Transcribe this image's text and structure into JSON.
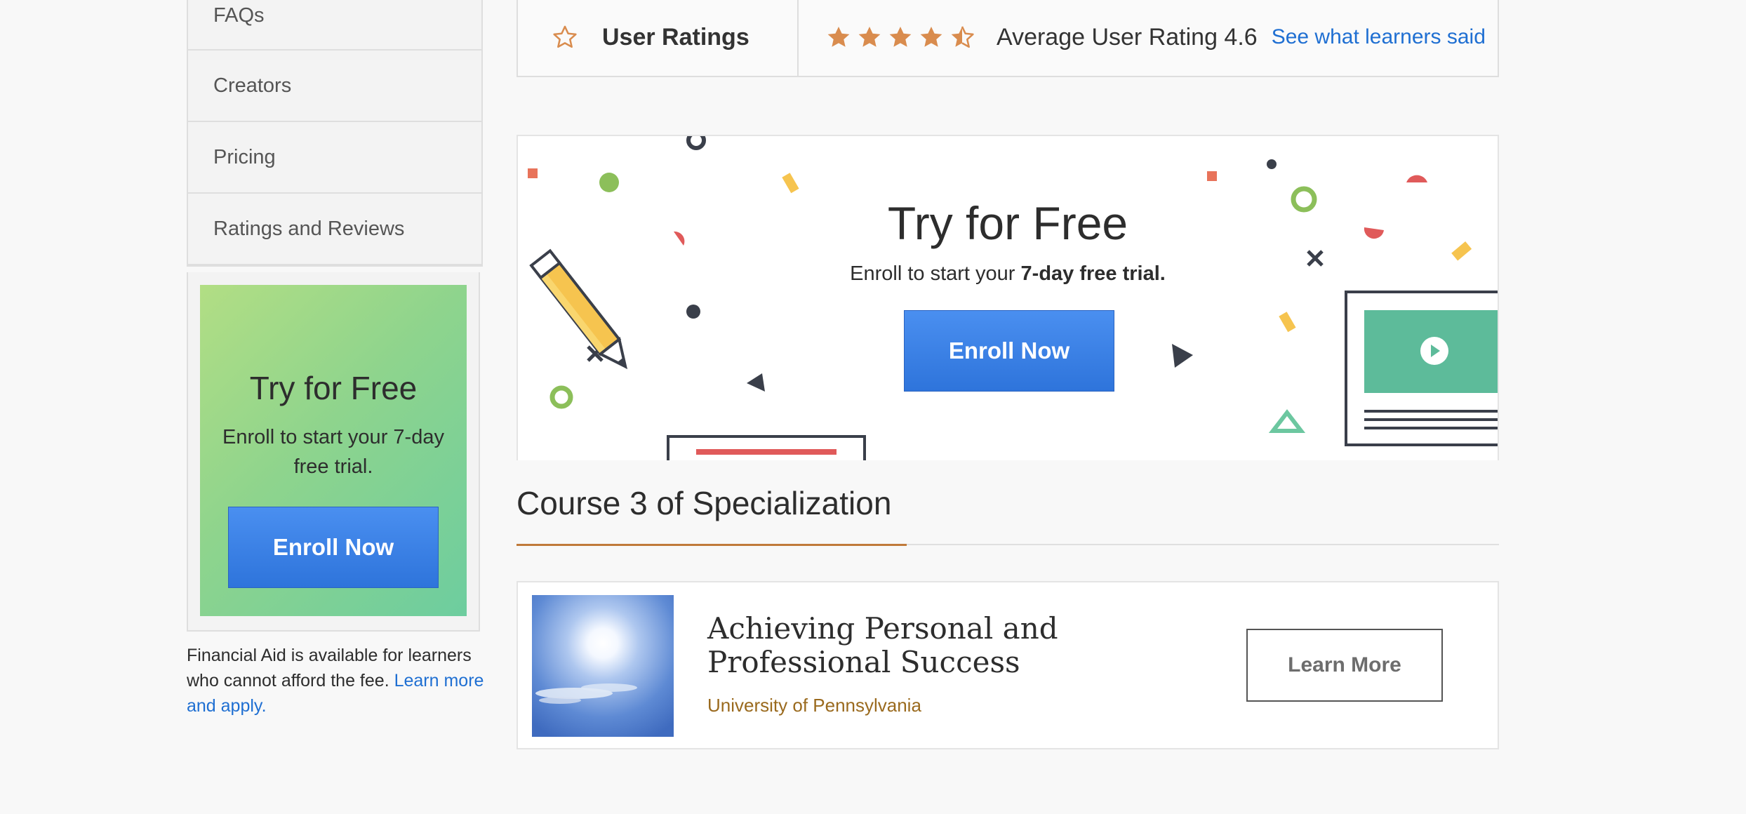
{
  "sidebar": {
    "nav_items": [
      {
        "label": "FAQs"
      },
      {
        "label": "Creators"
      },
      {
        "label": "Pricing"
      },
      {
        "label": "Ratings and Reviews"
      }
    ],
    "promo": {
      "title": "Try for Free",
      "text": "Enroll to start your 7-day free trial.",
      "button": "Enroll Now"
    },
    "financial_aid": {
      "text": "Financial Aid is available for learners who cannot afford the fee.",
      "link": "Learn more and apply."
    }
  },
  "ratings": {
    "label": "User Ratings",
    "rating_value": 4.6,
    "stars_filled": 4,
    "stars_half": 1,
    "average_text": "Average User Rating 4.6",
    "link": "See what learners said",
    "star_color": "#d98c4e"
  },
  "banner": {
    "title": "Try for Free",
    "text_prefix": "Enroll to start your",
    "text_bold": "7-day free trial.",
    "button": "Enroll Now"
  },
  "specialization": {
    "heading": "Course 3 of Specialization",
    "course": {
      "title": "Achieving Personal and Professional Success",
      "organization": "University of Pennsylvania",
      "button": "Learn More"
    }
  },
  "colors": {
    "primary_button": "#2e74db",
    "link": "#1f6fd2",
    "accent_rule": "#c07a3a",
    "org_text": "#9a6a1e"
  }
}
